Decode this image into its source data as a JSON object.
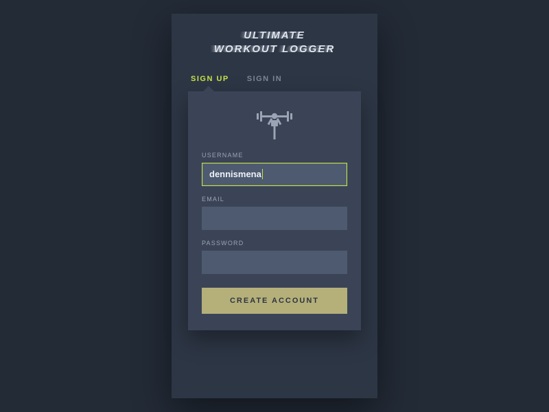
{
  "app": {
    "title_line1": "Ultimate",
    "title_line2": "Workout Logger"
  },
  "tabs": {
    "signup": "Sign Up",
    "signin": "Sign In",
    "active": "signup"
  },
  "form": {
    "username_label": "Username",
    "username_value": "dennismena",
    "email_label": "Email",
    "email_value": "",
    "password_label": "Password",
    "password_value": "",
    "submit_label": "Create Account"
  },
  "icons": {
    "hero": "weightlifter-icon"
  },
  "colors": {
    "accent": "#c7e34a",
    "button": "#b5b07a"
  }
}
